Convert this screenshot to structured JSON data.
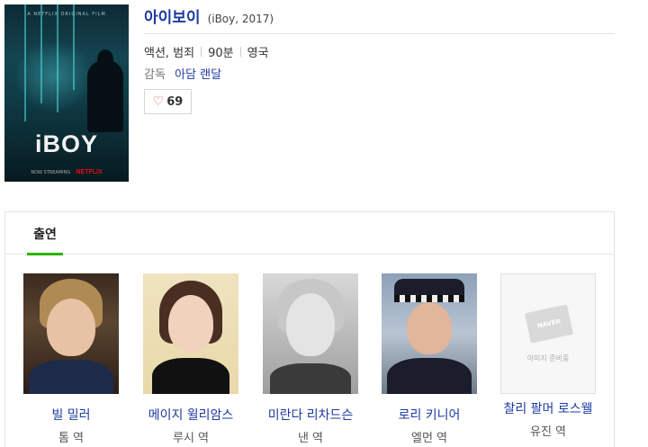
{
  "movie": {
    "title": "아이보이",
    "title_meta": "(iBoy, 2017)",
    "genre": "액션, 범죄",
    "runtime": "90분",
    "country": "영국",
    "director_label": "감독",
    "director_name": "아담 랜달",
    "like_count": "69"
  },
  "poster": {
    "top_text": "A NETFLIX ORIGINAL FILM",
    "title": "iBOY",
    "streaming": "NOW STREAMING",
    "brand": "NETFLIX"
  },
  "cast_panel": {
    "tab_label": "출연",
    "members": [
      {
        "name": "빌 밀러",
        "role": "톰 역"
      },
      {
        "name": "메이지 윌리암스",
        "role": "루시 역"
      },
      {
        "name": "미란다 리차드슨",
        "role": "낸 역"
      },
      {
        "name": "로리 키니어",
        "role": "엘먼 역"
      },
      {
        "name": "찰리 팔머 로스웰",
        "role": "유진 역"
      }
    ],
    "placeholder_brand": "NAVER",
    "placeholder_text": "이미지 준비중"
  },
  "colors": {
    "link_blue": "#1d3aa0",
    "tab_accent": "#2db400",
    "heart": "#e45a5a",
    "netflix_red": "#e50914"
  }
}
